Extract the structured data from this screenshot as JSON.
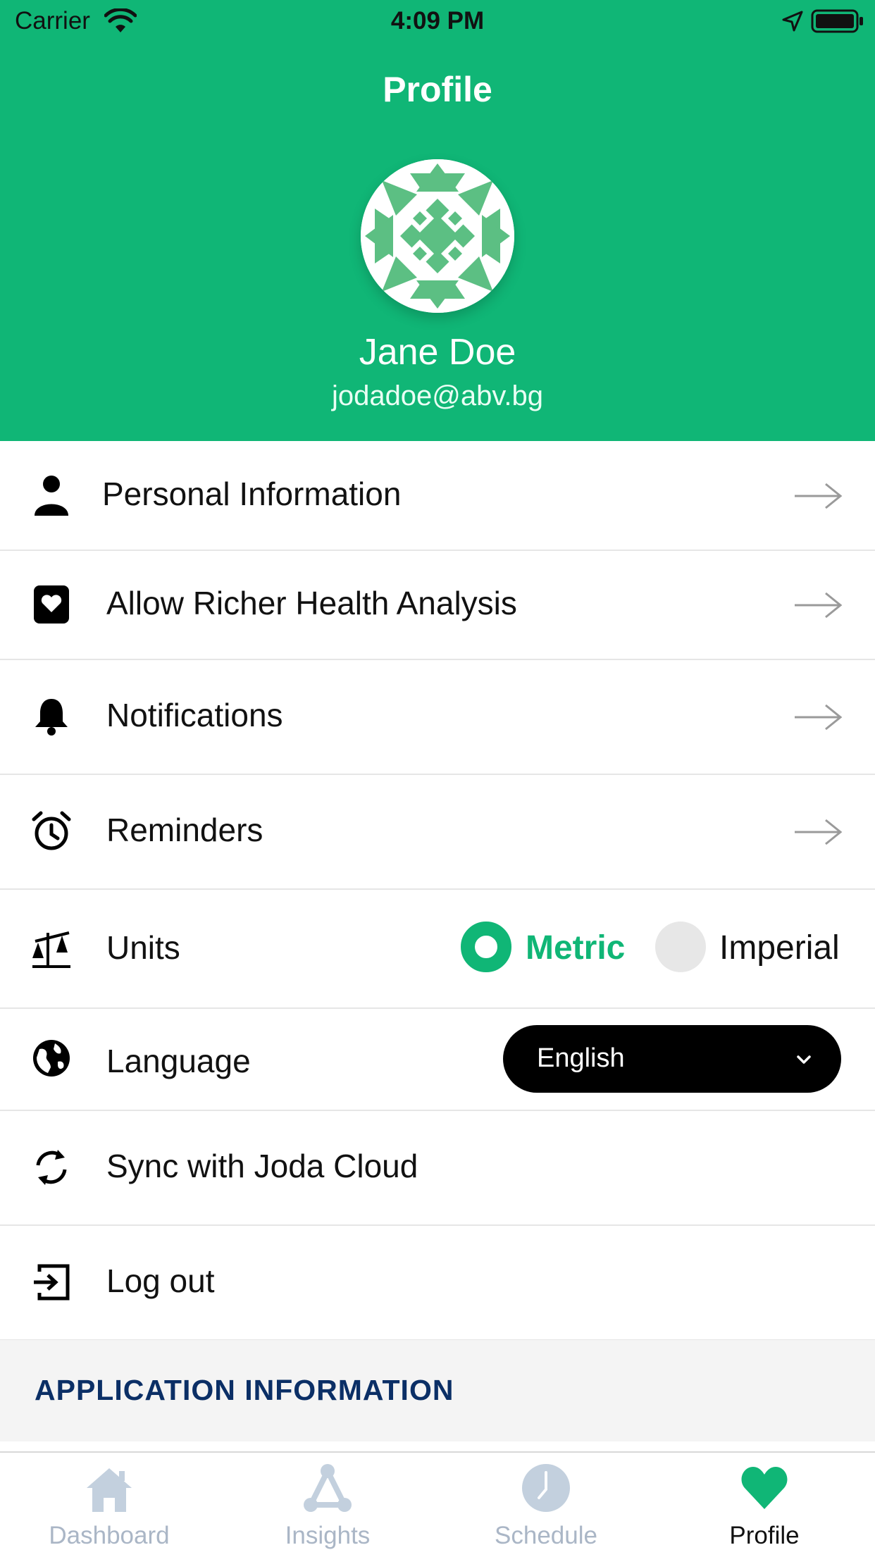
{
  "status_bar": {
    "carrier": "Carrier",
    "time": "4:09 PM"
  },
  "header": {
    "title": "Profile",
    "name": "Jane Doe",
    "email": "jodadoe@abv.bg",
    "background": "#10b676"
  },
  "menu": {
    "personal_information": "Personal Information",
    "health_analysis": "Allow Richer Health Analysis",
    "notifications": "Notifications",
    "reminders": "Reminders",
    "units": "Units",
    "units_options": [
      "Metric",
      "Imperial"
    ],
    "units_selected": "Metric",
    "language": "Language",
    "language_value": "English",
    "sync": "Sync with Joda Cloud",
    "logout": "Log out"
  },
  "section": {
    "application_information": "APPLICATION INFORMATION"
  },
  "tabbar": {
    "tabs": [
      {
        "label": "Dashboard",
        "icon": "home-icon"
      },
      {
        "label": "Insights",
        "icon": "triangle-network-icon"
      },
      {
        "label": "Schedule",
        "icon": "clock-icon"
      },
      {
        "label": "Profile",
        "icon": "heart-icon"
      }
    ],
    "active": "Profile"
  },
  "colors": {
    "accent": "#10b676",
    "section_title": "#0b2f66",
    "tab_inactive": "#aab6c6"
  }
}
